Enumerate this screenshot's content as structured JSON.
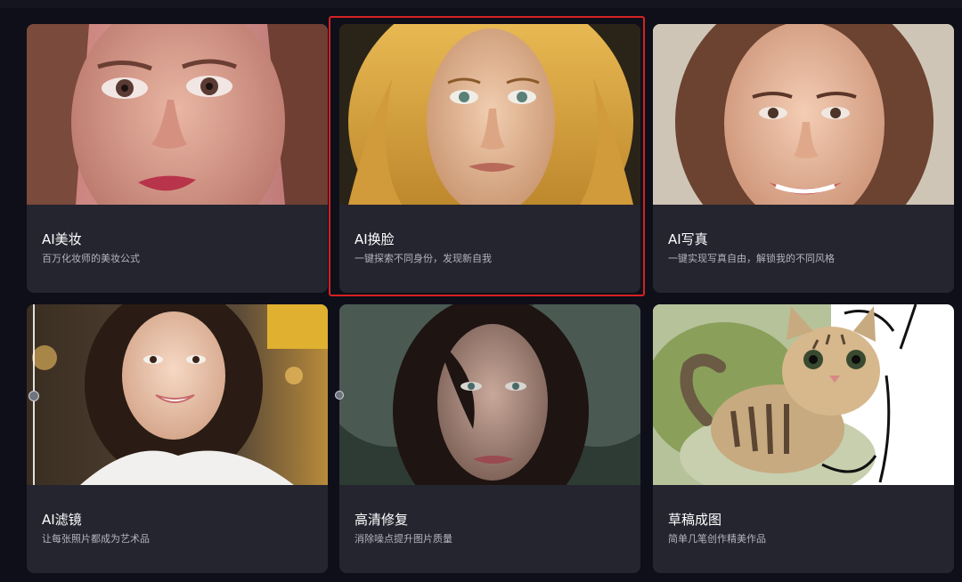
{
  "cards": [
    {
      "title": "AI美妆",
      "desc": "百万化妆师的美妆公式",
      "icon": "portrait-makeup-image"
    },
    {
      "title": "AI换脸",
      "desc": "一键探索不同身份，发现新自我",
      "icon": "portrait-faceswap-image",
      "selected": true
    },
    {
      "title": "AI写真",
      "desc": "一键实现写真自由，解锁我的不同风格",
      "icon": "portrait-photo-image"
    },
    {
      "title": "AI滤镜",
      "desc": "让每张照片都成为艺术品",
      "icon": "portrait-filter-image"
    },
    {
      "title": "高清修复",
      "desc": "消除噪点提升图片质量",
      "icon": "portrait-restore-image"
    },
    {
      "title": "草稿成图",
      "desc": "简单几笔创作精美作品",
      "icon": "kitten-sketch-image"
    }
  ],
  "colors": {
    "background": "#0f0f1a",
    "card": "#252530",
    "selected_border": "#d42222"
  }
}
